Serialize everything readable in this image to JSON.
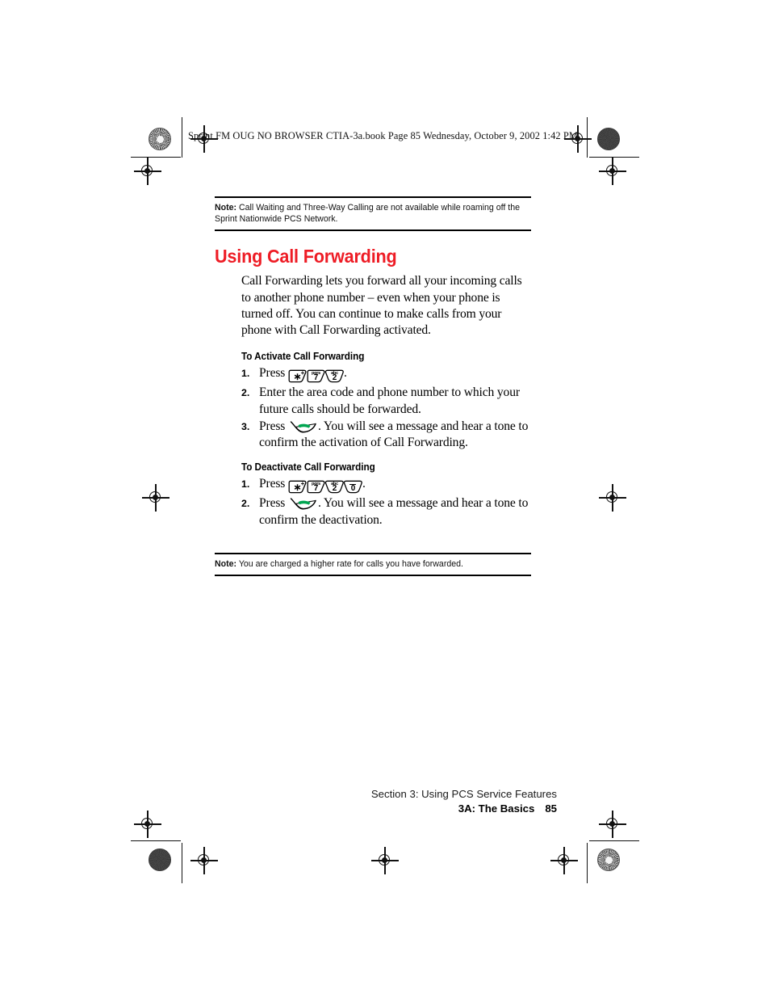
{
  "header": {
    "slug": "Sprint FM OUG NO BROWSER CTIA-3a.book  Page 85  Wednesday, October 9, 2002  1:42 PM"
  },
  "accent_color": "#ee1c25",
  "notes": {
    "top": {
      "label": "Note:",
      "text": " Call Waiting and Three-Way Calling are not available while roaming off the Sprint Nationwide PCS Network."
    },
    "bottom": {
      "label": "Note:",
      "text": " You are charged a higher rate for calls you have forwarded."
    }
  },
  "section": {
    "heading": "Using Call Forwarding",
    "paragraph": "Call Forwarding lets you forward all your incoming calls to another phone number – even when your phone is turned off. You can continue to make calls from your phone with Call Forwarding activated."
  },
  "procedures": [
    {
      "title": "To Activate Call Forwarding",
      "steps": [
        {
          "number": "1.",
          "pre": "Press ",
          "keys": [
            {
              "name": "key-star",
              "main": "∗",
              "sup": "+"
            },
            {
              "name": "key-7",
              "main": "7",
              "sup": "pqrs"
            },
            {
              "name": "key-2",
              "main": "2",
              "sup": "abc"
            }
          ],
          "post": "."
        },
        {
          "number": "2.",
          "pre": "Enter the area code and phone number to which your future calls should be forwarded.",
          "keys": [],
          "post": ""
        },
        {
          "number": "3.",
          "pre": "Press ",
          "keys": [
            {
              "name": "key-talk",
              "main": "talk",
              "sup": ""
            }
          ],
          "post": ". You will see a message and hear a tone to confirm the activation of Call Forwarding."
        }
      ]
    },
    {
      "title": "To Deactivate Call Forwarding",
      "steps": [
        {
          "number": "1.",
          "pre": "Press ",
          "keys": [
            {
              "name": "key-star",
              "main": "∗",
              "sup": "+"
            },
            {
              "name": "key-7",
              "main": "7",
              "sup": "pqrs"
            },
            {
              "name": "key-2",
              "main": "2",
              "sup": "abc"
            },
            {
              "name": "key-0",
              "main": "0",
              "sup": "bar"
            }
          ],
          "post": "."
        },
        {
          "number": "2.",
          "pre": "Press ",
          "keys": [
            {
              "name": "key-talk",
              "main": "talk",
              "sup": ""
            }
          ],
          "post": ". You will see a message and hear a tone to confirm the deactivation."
        }
      ]
    }
  ],
  "footer": {
    "section_line": "Section 3: Using PCS Service Features",
    "chapter_line": "3A: The Basics",
    "page_number": "85"
  }
}
